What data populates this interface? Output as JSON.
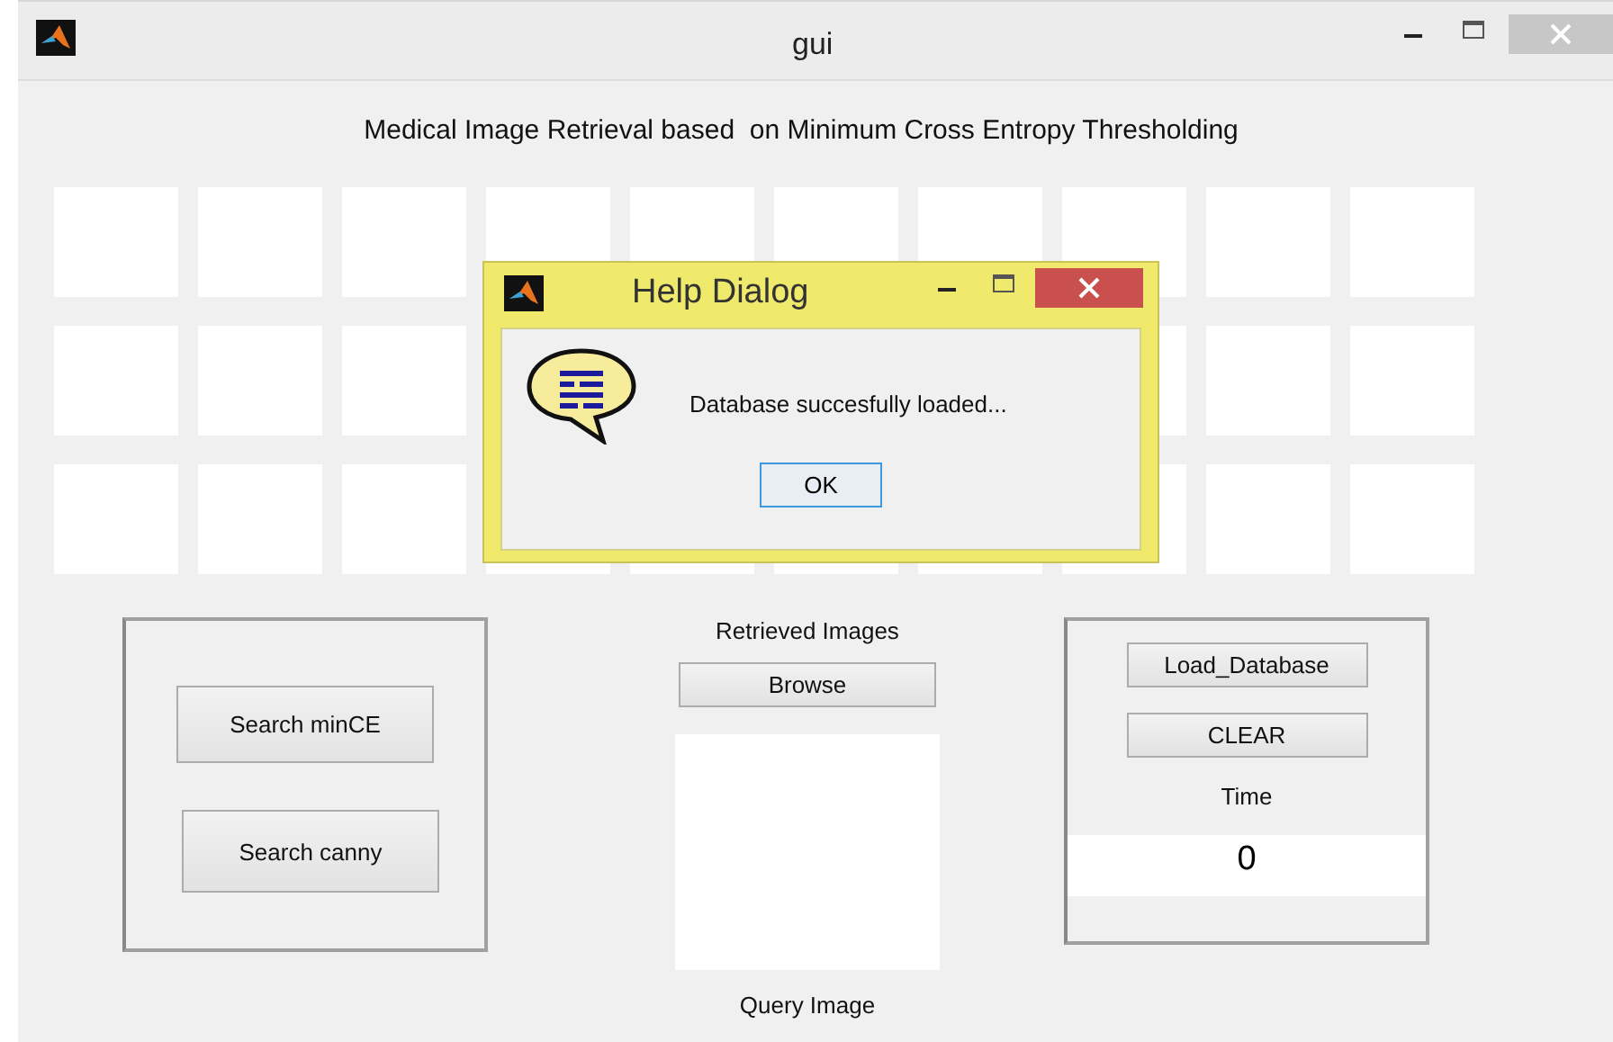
{
  "window": {
    "title": "gui"
  },
  "heading": "Medical Image Retrieval based  on Minimum Cross Entropy Thresholding",
  "left_panel": {
    "buttons": [
      "Search minCE",
      "Search canny"
    ]
  },
  "center": {
    "label": "Retrieved Images",
    "button": "Browse",
    "caption": "Query Image"
  },
  "right_panel": {
    "buttons": [
      "Load_Database",
      "CLEAR"
    ],
    "time_label": "Time",
    "time_value": "0"
  },
  "dialog": {
    "title": "Help Dialog",
    "message": "Database succesfully loaded...",
    "button": "OK"
  }
}
